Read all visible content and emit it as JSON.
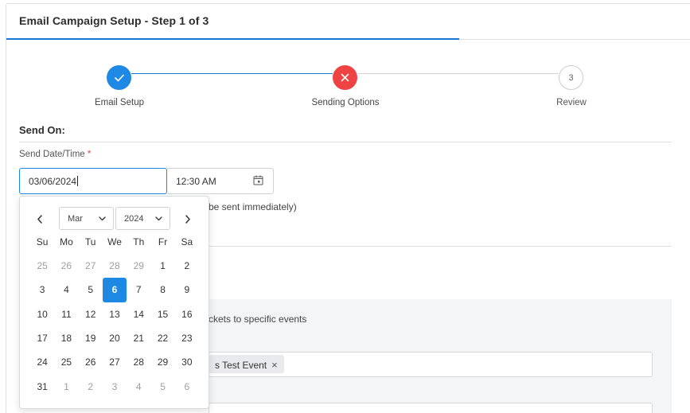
{
  "header": {
    "title": "Email Campaign Setup - Step 1 of 3"
  },
  "stepper": {
    "steps": [
      {
        "label": "Email Setup",
        "state": "done"
      },
      {
        "label": "Sending Options",
        "state": "error"
      },
      {
        "label": "Review",
        "state": "pending",
        "number": "3"
      }
    ]
  },
  "send_on": {
    "title": "Send On:",
    "field_label": "Send Date/Time",
    "required_mark": "*",
    "date_value": "03/06/2024",
    "time_value": "12:30 AM",
    "hint_fragment": "be sent immediately)"
  },
  "events": {
    "description_fragment": "ckets to specific events",
    "selected_tag": "s Test Event",
    "tag_remove": "×"
  },
  "datepicker": {
    "month": "Mar",
    "year": "2024",
    "weekdays": [
      "Su",
      "Mo",
      "Tu",
      "We",
      "Th",
      "Fr",
      "Sa"
    ],
    "weeks": [
      [
        {
          "d": "25",
          "m": true
        },
        {
          "d": "26",
          "m": true
        },
        {
          "d": "27",
          "m": true
        },
        {
          "d": "28",
          "m": true
        },
        {
          "d": "29",
          "m": true
        },
        {
          "d": "1"
        },
        {
          "d": "2"
        }
      ],
      [
        {
          "d": "3"
        },
        {
          "d": "4"
        },
        {
          "d": "5"
        },
        {
          "d": "6",
          "s": true
        },
        {
          "d": "7"
        },
        {
          "d": "8"
        },
        {
          "d": "9"
        }
      ],
      [
        {
          "d": "10"
        },
        {
          "d": "11"
        },
        {
          "d": "12"
        },
        {
          "d": "13"
        },
        {
          "d": "14"
        },
        {
          "d": "15"
        },
        {
          "d": "16"
        }
      ],
      [
        {
          "d": "17"
        },
        {
          "d": "18"
        },
        {
          "d": "19"
        },
        {
          "d": "20"
        },
        {
          "d": "21"
        },
        {
          "d": "22"
        },
        {
          "d": "23"
        }
      ],
      [
        {
          "d": "24"
        },
        {
          "d": "25"
        },
        {
          "d": "26"
        },
        {
          "d": "27"
        },
        {
          "d": "28"
        },
        {
          "d": "29"
        },
        {
          "d": "30"
        }
      ],
      [
        {
          "d": "31"
        },
        {
          "d": "1",
          "m": true
        },
        {
          "d": "2",
          "m": true
        },
        {
          "d": "3",
          "m": true
        },
        {
          "d": "4",
          "m": true
        },
        {
          "d": "5",
          "m": true
        },
        {
          "d": "6",
          "m": true
        }
      ]
    ]
  },
  "colors": {
    "accent": "#1e88e5",
    "error": "#ef4343",
    "selected_day": "#1e88e5"
  }
}
